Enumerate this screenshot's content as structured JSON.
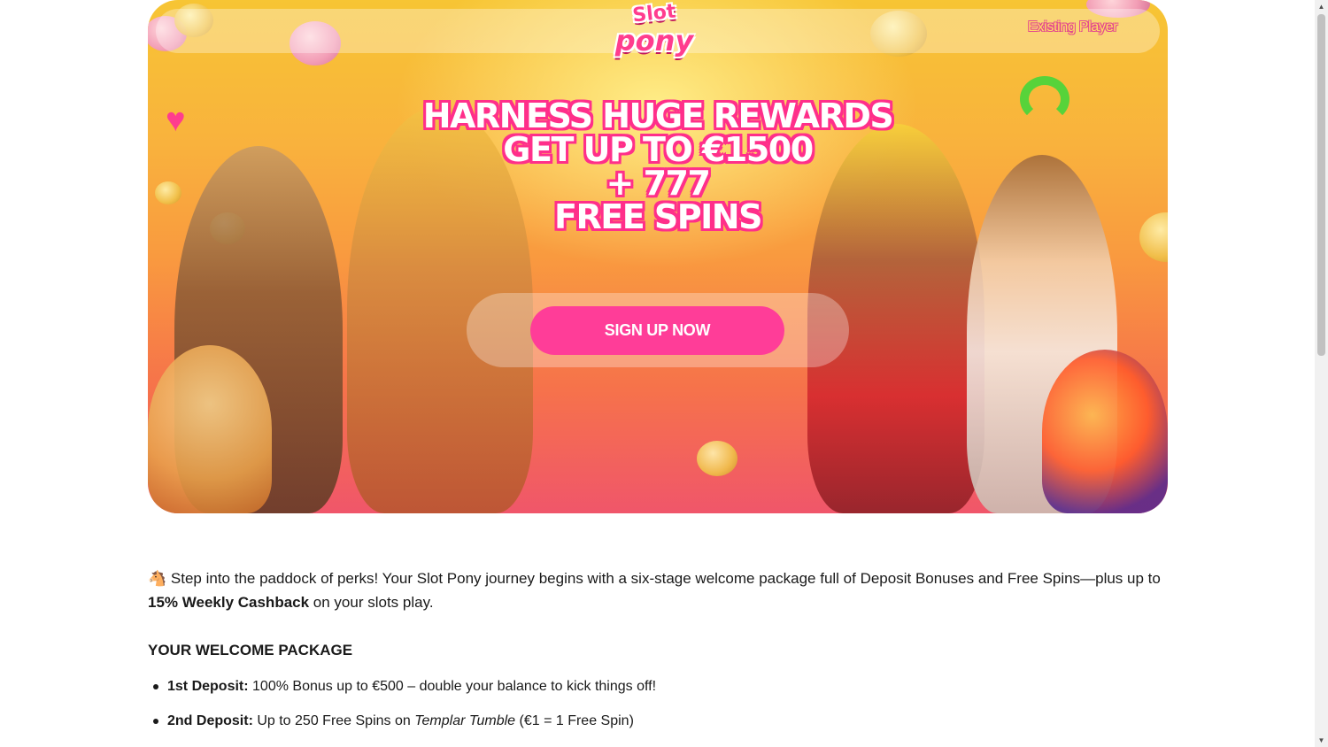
{
  "hero": {
    "logo_line1": "Slot",
    "logo_line2": "pony",
    "existing_player": "Existing Player",
    "headline": [
      "HARNESS HUGE REWARDS",
      "GET UP TO €1500",
      "+ 777",
      "FREE SPINS"
    ],
    "cta": "SIGN UP NOW"
  },
  "intro": {
    "icon": "🐴",
    "text_before": " Step into the paddock of perks! Your Slot Pony journey begins with a six-stage welcome package full of Deposit Bonuses and Free Spins—plus up to ",
    "highlight": "15% Weekly Cashback",
    "text_after": " on your slots play."
  },
  "package": {
    "title": "YOUR WELCOME PACKAGE",
    "items": [
      {
        "label": "1st Deposit:",
        "text": " 100% Bonus up to €500 – double your balance to kick things off!",
        "game": "",
        "suffix": ""
      },
      {
        "label": "2nd Deposit:",
        "text": " Up to 250 Free Spins on ",
        "game": "Templar Tumble",
        "suffix": " (€1 = 1 Free Spin)"
      }
    ]
  },
  "colors": {
    "brand_pink": "#ff3d98",
    "banner_top": "#f7c534",
    "banner_bottom": "#f0566a"
  }
}
